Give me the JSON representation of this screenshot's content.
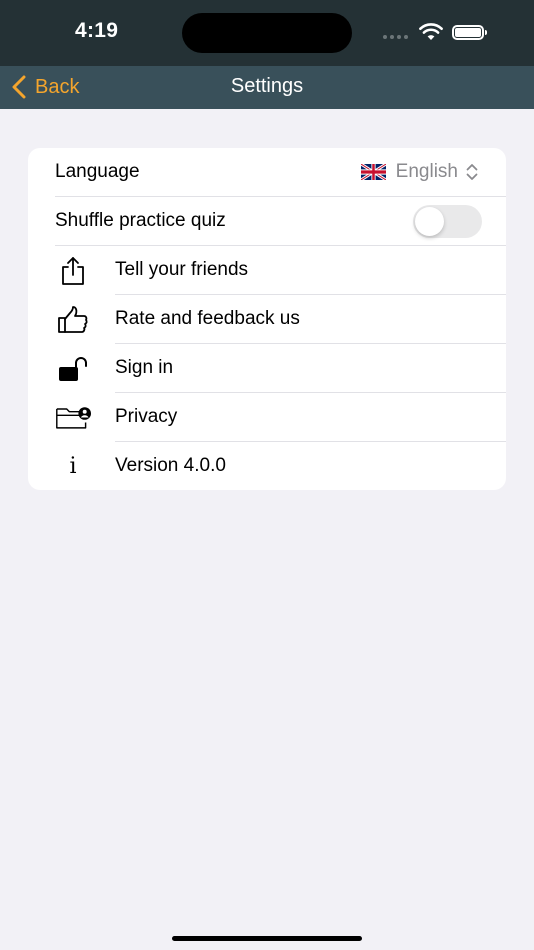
{
  "status_bar": {
    "time": "4:19"
  },
  "nav": {
    "back_label": "Back",
    "title": "Settings"
  },
  "settings": {
    "language": {
      "label": "Language",
      "value": "English",
      "flag_icon": "uk-flag-icon"
    },
    "shuffle": {
      "label": "Shuffle practice quiz",
      "enabled": false
    },
    "items": [
      {
        "label": "Tell your friends",
        "icon": "share-icon"
      },
      {
        "label": "Rate and feedback us",
        "icon": "thumbs-up-icon"
      },
      {
        "label": "Sign in",
        "icon": "unlock-icon"
      },
      {
        "label": "Privacy",
        "icon": "privacy-folder-icon"
      },
      {
        "label": "Version 4.0.0",
        "icon": "info-icon",
        "glyph": "i"
      }
    ]
  },
  "colors": {
    "accent": "#f4a52d",
    "nav_bg": "#39505a",
    "status_bg": "#243135",
    "page_bg": "#f2f1f6"
  }
}
